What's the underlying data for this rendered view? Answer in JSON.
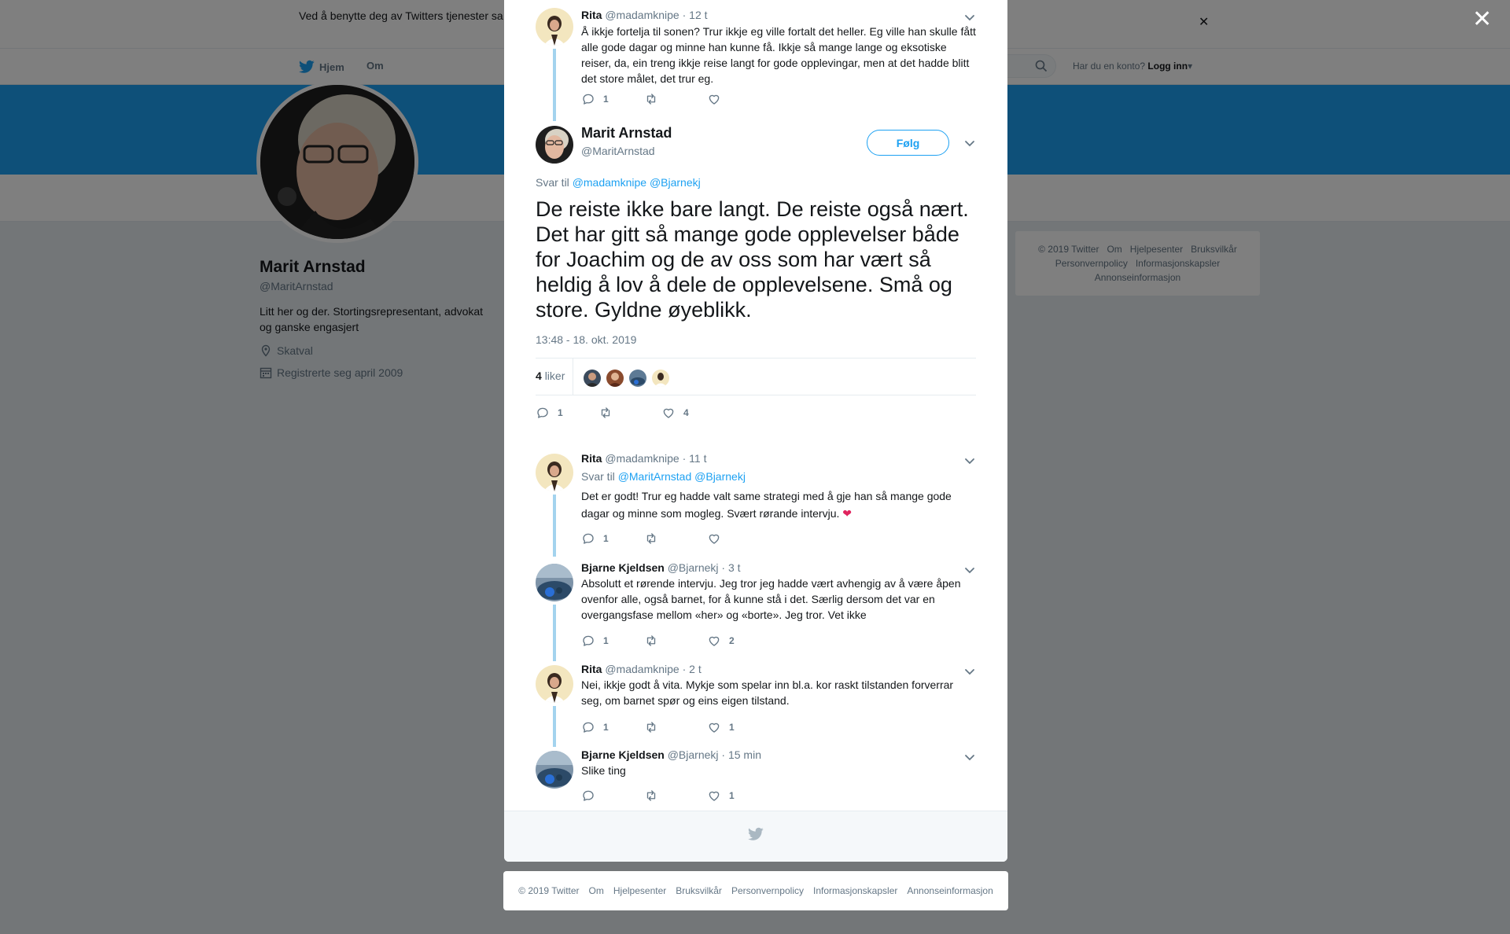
{
  "cookie_bar": {
    "text": "Ved å benytte deg av Twitters tjenester sa                                                                                                                    informasjonskapsler til bl.a. analyser, personalisering og annonser."
  },
  "topnav": {
    "home_label": "Hjem",
    "about_label": "Om",
    "account_prompt": "Har du en konto?",
    "login_label": "Logg inn"
  },
  "profile": {
    "name": "Marit Arnstad",
    "handle": "@MaritArnstad",
    "bio": "Litt her og der. Stortingsrepresentant, advokat og ganske engasjert",
    "location": "Skatval",
    "joined": "Registrerte seg april 2009"
  },
  "side_footer": {
    "items": [
      "© 2019 Twitter",
      "Om",
      "Hjelpesenter",
      "Bruksvilkår",
      "Personvernpolicy",
      "Informasjonskapsler",
      "Annonseinformasjon"
    ]
  },
  "modal": {
    "parent_tweet": {
      "name": "Rita",
      "handle": "@madamknipe",
      "time": "· 12 t",
      "text": "Å ikkje fortelja til sonen? Trur ikkje eg ville fortalt det heller. Eg ville han skulle fått alle gode dagar og minne han kunne få. Ikkje så mange lange og eksotiske reiser, da, ein treng ikkje reise langt for gode opplevingar, men at det hadde blitt det store målet, det trur eg.",
      "replies": "1",
      "retweets": "",
      "likes": ""
    },
    "main_tweet": {
      "name": "Marit Arnstad",
      "handle": "@MaritArnstad",
      "follow_label": "Følg",
      "reply_to_prefix": "Svar til",
      "reply_to_users": "@madamknipe @Bjarnekj",
      "text": "De reiste ikke bare langt. De reiste også nært. Det har gitt så mange gode opplevelser både for Joachim og de av oss som har vært så heldig å lov å dele de opplevelsene. Små og store. Gyldne øyeblikk.",
      "timestamp": "13:48 - 18. okt. 2019",
      "likes_count": "4",
      "likes_label": "liker",
      "replies": "1",
      "retweets": "",
      "likes": "4"
    },
    "replies": [
      {
        "name": "Rita",
        "handle": "@madamknipe",
        "time": "· 11 t",
        "reply_to_prefix": "Svar til",
        "reply_to_users": "@MaritArnstad @Bjarnekj",
        "text": "Det er godt! Trur eg hadde valt same strategi med å gje han så mange gode dagar og minne som mogleg. Svært rørande intervju.",
        "emoji": "❤",
        "replies": "1",
        "retweets": "",
        "likes": ""
      },
      {
        "name": "Bjarne Kjeldsen",
        "handle": "@Bjarnekj",
        "time": "· 3 t",
        "text": "Absolutt et rørende intervju. Jeg tror jeg hadde vært avhengig av å være åpen ovenfor alle, også barnet, for å kunne stå i det. Særlig dersom det var en overgangsfase mellom «her» og «borte». Jeg tror. Vet ikke",
        "replies": "1",
        "retweets": "",
        "likes": "2"
      },
      {
        "name": "Rita",
        "handle": "@madamknipe",
        "time": "· 2 t",
        "text": "Nei, ikkje godt å vita. Mykje som spelar inn bl.a. kor raskt tilstanden forverrar seg, om barnet spør og eins eigen tilstand.",
        "replies": "1",
        "retweets": "",
        "likes": "1"
      },
      {
        "name": "Bjarne Kjeldsen",
        "handle": "@Bjarnekj",
        "time": "· 15 min",
        "text": "Slike ting",
        "replies": "",
        "retweets": "",
        "likes": "1"
      }
    ]
  },
  "page_footer": {
    "items": [
      "© 2019 Twitter",
      "Om",
      "Hjelpesenter",
      "Bruksvilkår",
      "Personvernpolicy",
      "Informasjonskapsler",
      "Annonseinformasjon"
    ]
  },
  "icons": {
    "reply": "reply-icon",
    "retweet": "retweet-icon",
    "like": "heart-icon",
    "caret": "chevron-down-icon",
    "close": "close-icon",
    "brand": "twitter-bird-icon"
  },
  "colors": {
    "accent": "#1da1f2",
    "thread_line": "#a3d3ee",
    "heart": "#e0245e"
  }
}
